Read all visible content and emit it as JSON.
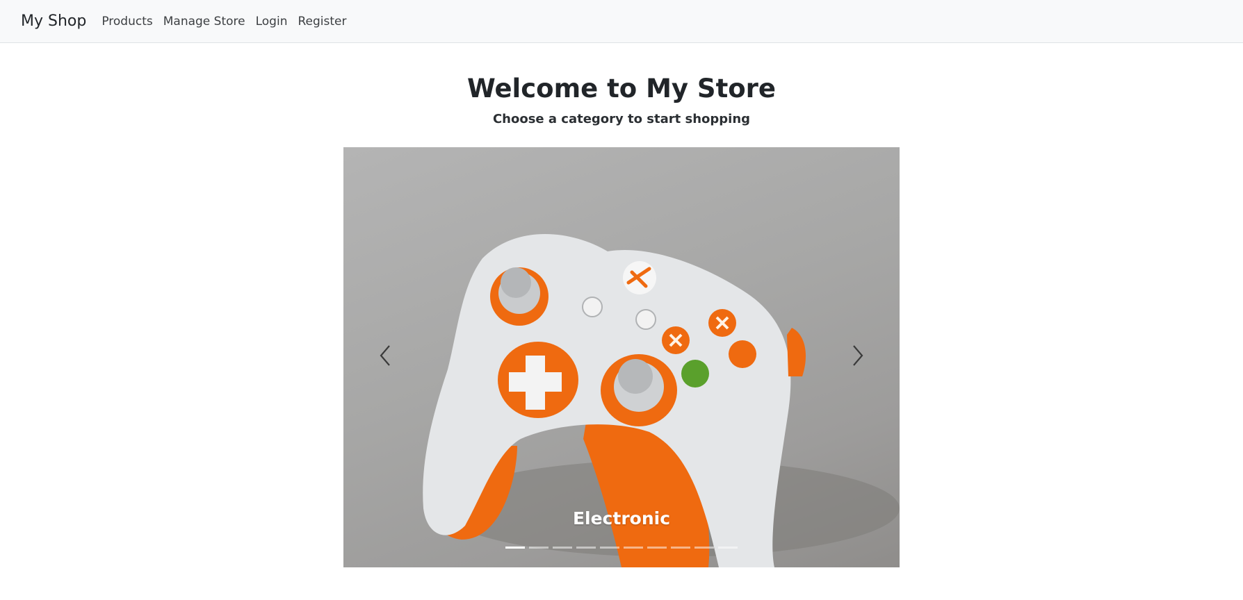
{
  "navbar": {
    "brand": "My Shop",
    "links": [
      "Products",
      "Manage Store",
      "Login",
      "Register"
    ]
  },
  "hero": {
    "title": "Welcome to My Store",
    "subtitle": "Choose a category to start shopping"
  },
  "carousel": {
    "slide_image": "orange-white-game-controller",
    "caption": "Electronic",
    "active_index": 0,
    "slide_count": 10,
    "prev_icon": "chevron-left-icon",
    "next_icon": "chevron-right-icon"
  },
  "colors": {
    "navbar_bg": "#f8f9fa",
    "text": "#212529",
    "controller_orange": "#f26b0f",
    "controller_white": "#e6e8ea"
  }
}
